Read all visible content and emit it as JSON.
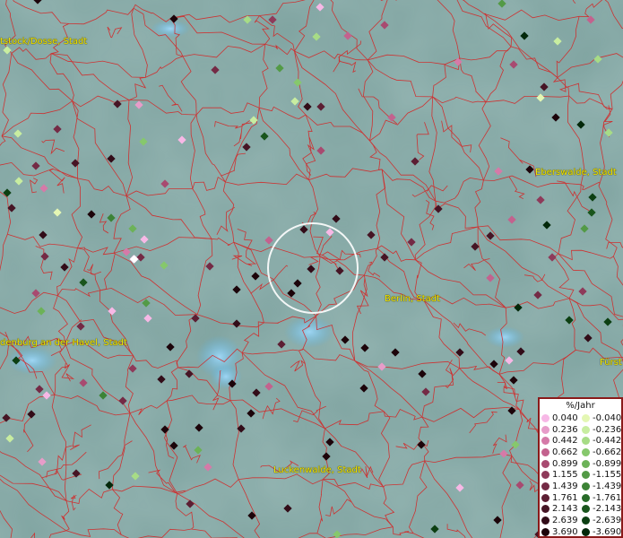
{
  "map": {
    "cities": [
      {
        "name": "Wittstock/Dosse, Stadt",
        "label": "tstock/Dosse, Stadt"
      },
      {
        "name": "Eberswalde, Stadt",
        "label": "Eberswalde, Stadt"
      },
      {
        "name": "Berlin, Stadt",
        "label": "Berlin, Stadt"
      },
      {
        "name": "Brandenburg an der Havel, Stadt",
        "label": "denburg an der Havel, Stadt"
      },
      {
        "name": "Fürstenwalde",
        "label": "Fürst"
      },
      {
        "name": "Luckenwalde, Stadt",
        "label": "Luckenwalde, Stadt"
      }
    ],
    "colors": {
      "background": "#7fa3a0",
      "boundaries": "#d81e1e",
      "water": "#5ab4e6",
      "city_label": "#f3e600",
      "selection_circle": "#ffffff"
    }
  },
  "legend": {
    "unit": "%/Jahr",
    "positive": [
      {
        "value": "0.040",
        "color": "#f7b8e6"
      },
      {
        "value": "0.236",
        "color": "#e79cc9"
      },
      {
        "value": "0.442",
        "color": "#d57aa8"
      },
      {
        "value": "0.662",
        "color": "#c3628e"
      },
      {
        "value": "0.899",
        "color": "#a84a70"
      },
      {
        "value": "1.155",
        "color": "#8e3a5a"
      },
      {
        "value": "1.439",
        "color": "#742a45"
      },
      {
        "value": "1.761",
        "color": "#5c1e33"
      },
      {
        "value": "2.143",
        "color": "#461525"
      },
      {
        "value": "2.639",
        "color": "#320c18"
      },
      {
        "value": "3.690",
        "color": "#1c040a"
      }
    ],
    "negative": [
      {
        "value": "-0.040",
        "color": "#e4f7b4"
      },
      {
        "value": "-0.236",
        "color": "#c8eda0"
      },
      {
        "value": "-0.442",
        "color": "#a7dc86"
      },
      {
        "value": "-0.662",
        "color": "#86c86c"
      },
      {
        "value": "-0.899",
        "color": "#6cb258"
      },
      {
        "value": "-1.155",
        "color": "#539a46"
      },
      {
        "value": "-1.439",
        "color": "#3c8336"
      },
      {
        "value": "-1.761",
        "color": "#286b28"
      },
      {
        "value": "-2.143",
        "color": "#19551c"
      },
      {
        "value": "-2.639",
        "color": "#0c3f12"
      },
      {
        "value": "-3.690",
        "color": "#03280a"
      }
    ]
  }
}
